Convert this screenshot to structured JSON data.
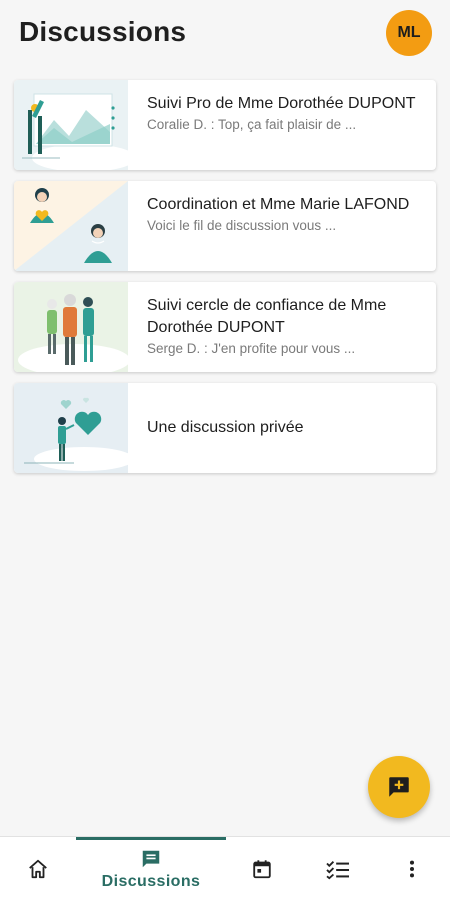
{
  "header": {
    "title": "Discussions",
    "avatar_initials": "ML"
  },
  "conversations": [
    {
      "title": "Suivi Pro de Mme Dorothée DUPONT",
      "preview": "Coralie D. : Top, ça fait plaisir de ...",
      "thumbnail": "chart-illustration"
    },
    {
      "title": "Coordination et Mme Marie LAFOND",
      "preview": "Voici le fil de discussion vous ...",
      "thumbnail": "care-team-illustration"
    },
    {
      "title": "Suivi cercle de confiance de Mme Dorothée DUPONT",
      "preview": "Serge D. : J'en profite pour vous ...",
      "thumbnail": "family-illustration"
    },
    {
      "title": "Une discussion privée",
      "preview": "",
      "thumbnail": "heart-illustration"
    }
  ],
  "fab": {
    "icon": "add-chat-icon"
  },
  "bottom_nav": {
    "items": [
      {
        "icon": "home-icon",
        "label": ""
      },
      {
        "icon": "chat-icon",
        "label": "Discussions",
        "active": true
      },
      {
        "icon": "calendar-icon",
        "label": ""
      },
      {
        "icon": "checklist-icon",
        "label": ""
      },
      {
        "icon": "more-vert-icon",
        "label": ""
      }
    ]
  },
  "colors": {
    "accent": "#2a6d64",
    "avatar": "#f39c12",
    "fab": "#f2b91f",
    "teal_illustration": "#2f9e94"
  }
}
